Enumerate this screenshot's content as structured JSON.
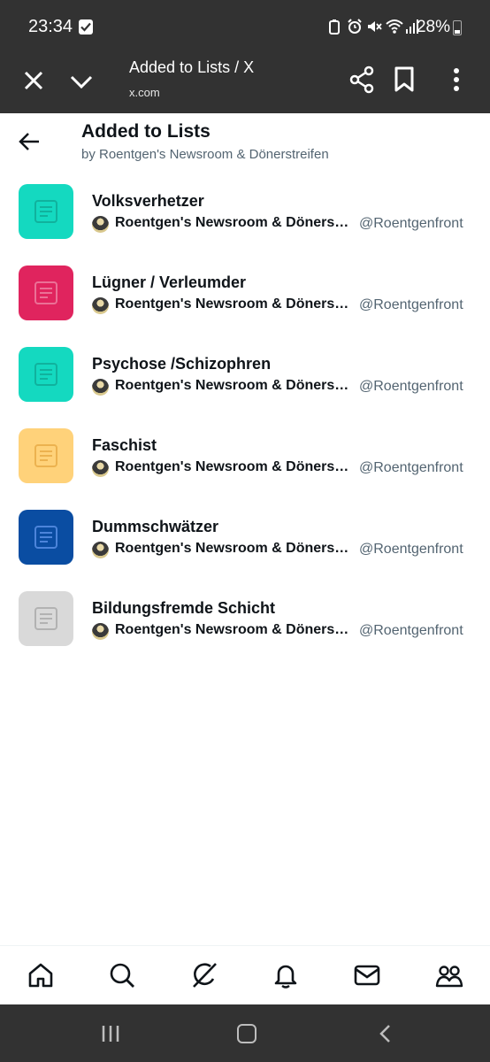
{
  "status_bar": {
    "time": "23:34",
    "battery": "28%"
  },
  "browser": {
    "title": "Added to Lists / X",
    "url": "x.com"
  },
  "page": {
    "title": "Added to Lists",
    "subtitle": "by Roentgen's Newsroom & Dönerstreifen"
  },
  "lists": [
    {
      "name": "Volksverhetzer",
      "owner": "Roentgen's Newsroom & Dönerstreifen",
      "handle": "@Roentgenfront",
      "color": "#14d9c0"
    },
    {
      "name": "Lügner / Verleumder",
      "owner": "Roentgen's Newsroom & Dönerstreifen",
      "handle": "@Roentgenfront",
      "color": "#e0245e"
    },
    {
      "name": "Psychose /Schizophren",
      "owner": "Roentgen's Newsroom & Dönerstreifen",
      "handle": "@Roentgenfront",
      "color": "#14d9c0"
    },
    {
      "name": "Faschist",
      "owner": "Roentgen's Newsroom & Dönerstreifen",
      "handle": "@Roentgenfront",
      "color": "#ffd27a"
    },
    {
      "name": "Dummschwätzer",
      "owner": "Roentgen's Newsroom & Dönerstreifen",
      "handle": "@Roentgenfront",
      "color": "#0a4da2"
    },
    {
      "name": "Bildungsfremde Schicht",
      "owner": "Roentgen's Newsroom & Dönerstreifen",
      "handle": "@Roentgenfront",
      "color": "#d9d9d9"
    }
  ],
  "icons": {
    "browser": [
      "close-icon",
      "chevron-down-icon",
      "share-icon",
      "bookmark-icon",
      "more-vertical-icon"
    ],
    "tabs": [
      "home-icon",
      "search-icon",
      "grok-icon",
      "notifications-icon",
      "messages-icon",
      "communities-icon"
    ],
    "nav": [
      "recent-apps-icon",
      "home-nav-icon",
      "back-nav-icon"
    ]
  }
}
